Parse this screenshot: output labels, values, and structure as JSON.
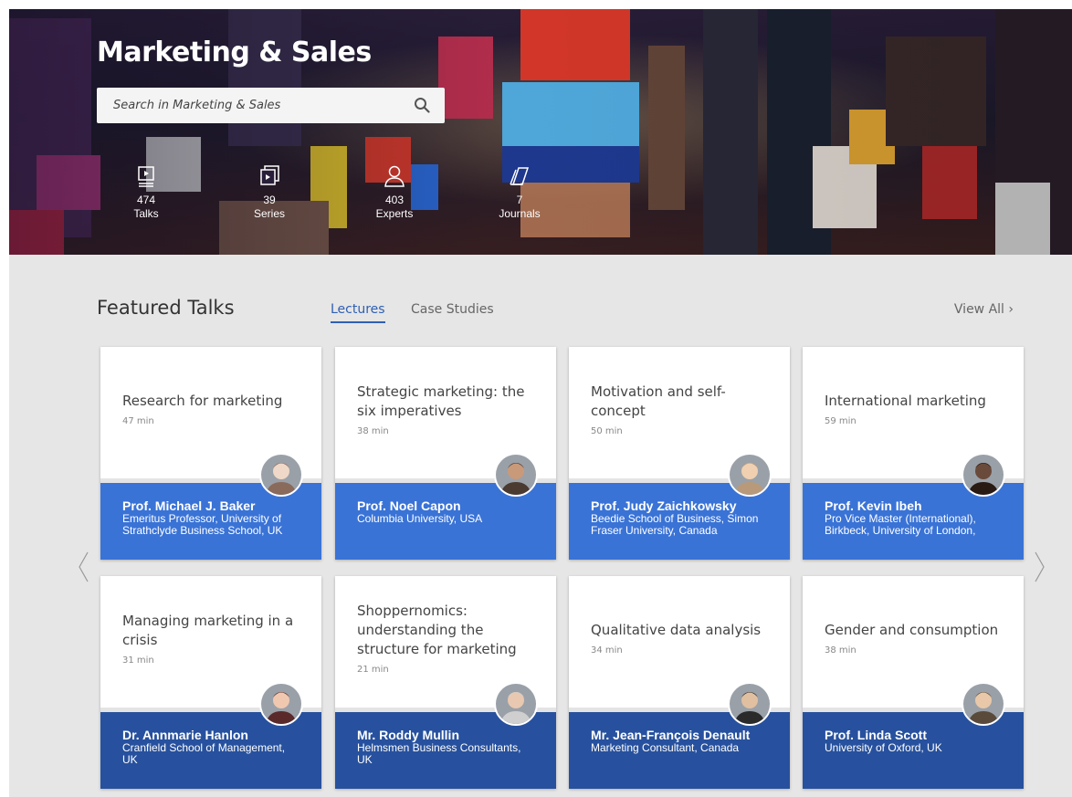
{
  "hero": {
    "title": "Marketing & Sales",
    "search_placeholder": "Search in Marketing & Sales",
    "stats": [
      {
        "icon": "video-play-icon",
        "count": "474",
        "label": "Talks"
      },
      {
        "icon": "series-stack-icon",
        "count": "39",
        "label": "Series"
      },
      {
        "icon": "expert-person-icon",
        "count": "403",
        "label": "Experts"
      },
      {
        "icon": "journals-icon",
        "count": "7",
        "label": "Journals"
      }
    ]
  },
  "featured": {
    "title": "Featured Talks",
    "tabs": [
      {
        "label": "Lectures",
        "active": true
      },
      {
        "label": "Case Studies",
        "active": false
      }
    ],
    "view_all": "View All"
  },
  "cards": [
    {
      "title": "Research for marketing",
      "duration": "47 min",
      "name": "Prof. Michael J. Baker",
      "affiliation": "Emeritus Professor, University of Strathclyde Business School, UK",
      "band_color": "#3a73d6"
    },
    {
      "title": "Strategic marketing: the six imperatives",
      "duration": "38 min",
      "name": "Prof. Noel Capon",
      "affiliation": "Columbia University, USA",
      "band_color": "#3a73d6"
    },
    {
      "title": "Motivation and self-concept",
      "duration": "50 min",
      "name": "Prof. Judy Zaichkowsky",
      "affiliation": "Beedie School of Business, Simon Fraser University, Canada",
      "band_color": "#3a73d6"
    },
    {
      "title": "International marketing",
      "duration": "59 min",
      "name": "Prof. Kevin Ibeh",
      "affiliation": "Pro Vice Master (International), Birkbeck, University of London,",
      "band_color": "#3a73d6"
    },
    {
      "title": "Managing marketing in a crisis",
      "duration": "31 min",
      "name": "Dr. Annmarie Hanlon",
      "affiliation": "Cranfield School of Management, UK",
      "band_color": "#27519e"
    },
    {
      "title": "Shoppernomics: understanding the structure for marketing",
      "duration": "21 min",
      "name": "Mr. Roddy Mullin",
      "affiliation": "Helmsmen Business Consultants, UK",
      "band_color": "#27519e"
    },
    {
      "title": "Qualitative data analysis",
      "duration": "34 min",
      "name": "Mr. Jean-François Denault",
      "affiliation": "Marketing Consultant, Canada",
      "band_color": "#27519e"
    },
    {
      "title": "Gender and consumption",
      "duration": "38 min",
      "name": "Prof. Linda Scott",
      "affiliation": "University of Oxford, UK",
      "band_color": "#27519e"
    }
  ]
}
